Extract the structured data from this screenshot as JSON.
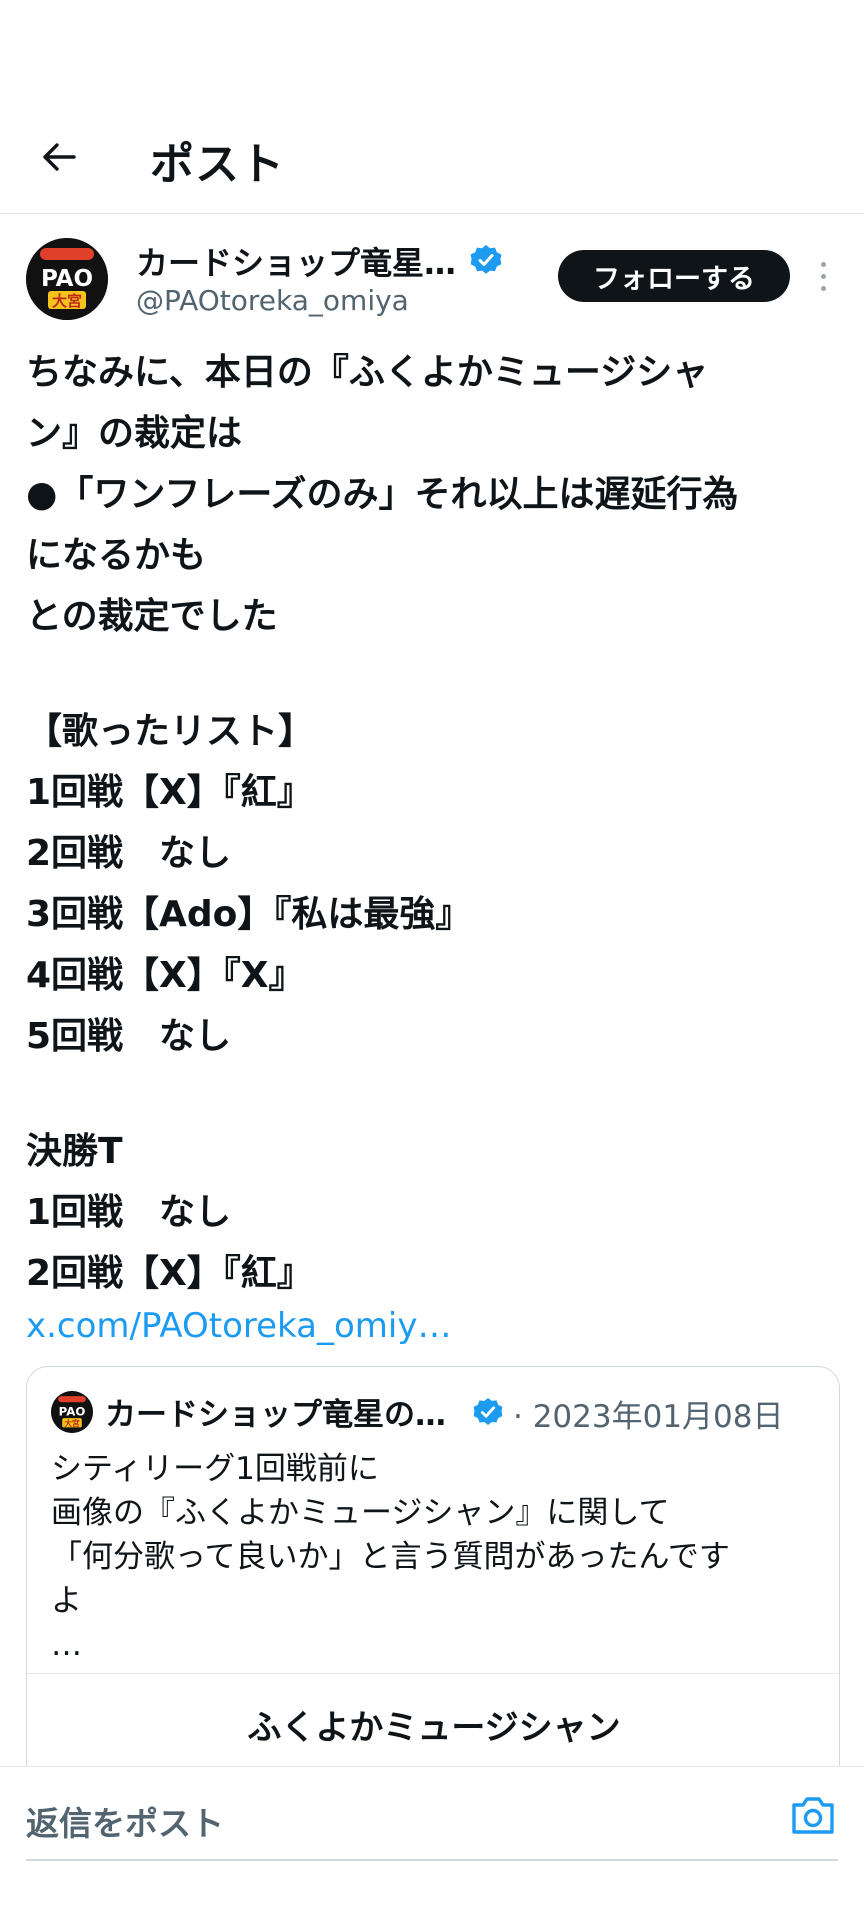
{
  "header": {
    "title": "ポスト"
  },
  "post": {
    "author_name": "カードショップ竜星…",
    "author_handle": "@PAOtoreka_omiya",
    "avatar_text_top": "PAO",
    "avatar_text_bottom": "大宮",
    "follow_label": "フォローする",
    "body_lines": [
      "ちなみに、本日の『ふくよかミュージシャ",
      "ン』の裁定は",
      "●「ワンフレーズのみ」それ以上は遅延行為",
      "になるかも",
      "との裁定でした",
      "",
      "【歌ったリスト】",
      "1回戦【X】『紅』",
      "2回戦　なし",
      "3回戦【Ado】『私は最強』",
      "4回戦【X】『X』",
      "5回戦　なし",
      "",
      "決勝T",
      "1回戦　なし",
      "2回戦【X】『紅』"
    ],
    "link": "x.com/PAOtoreka_omiy…"
  },
  "quote": {
    "author_name": "カードショップ竜星の…",
    "date": "· 2023年01月08日",
    "text_lines": [
      "シティリーグ1回戦前に",
      "画像の『ふくよかミュージシャン』に関して",
      "「何分歌って良いか」と言う質問があったんです",
      "よ",
      "…"
    ],
    "media_title": "ふくよかミュージシャン"
  },
  "reply": {
    "placeholder": "返信をポスト"
  },
  "colors": {
    "accent": "#1d9bf0",
    "text": "#0f1419",
    "muted": "#536471",
    "border": "#cfd9de"
  }
}
